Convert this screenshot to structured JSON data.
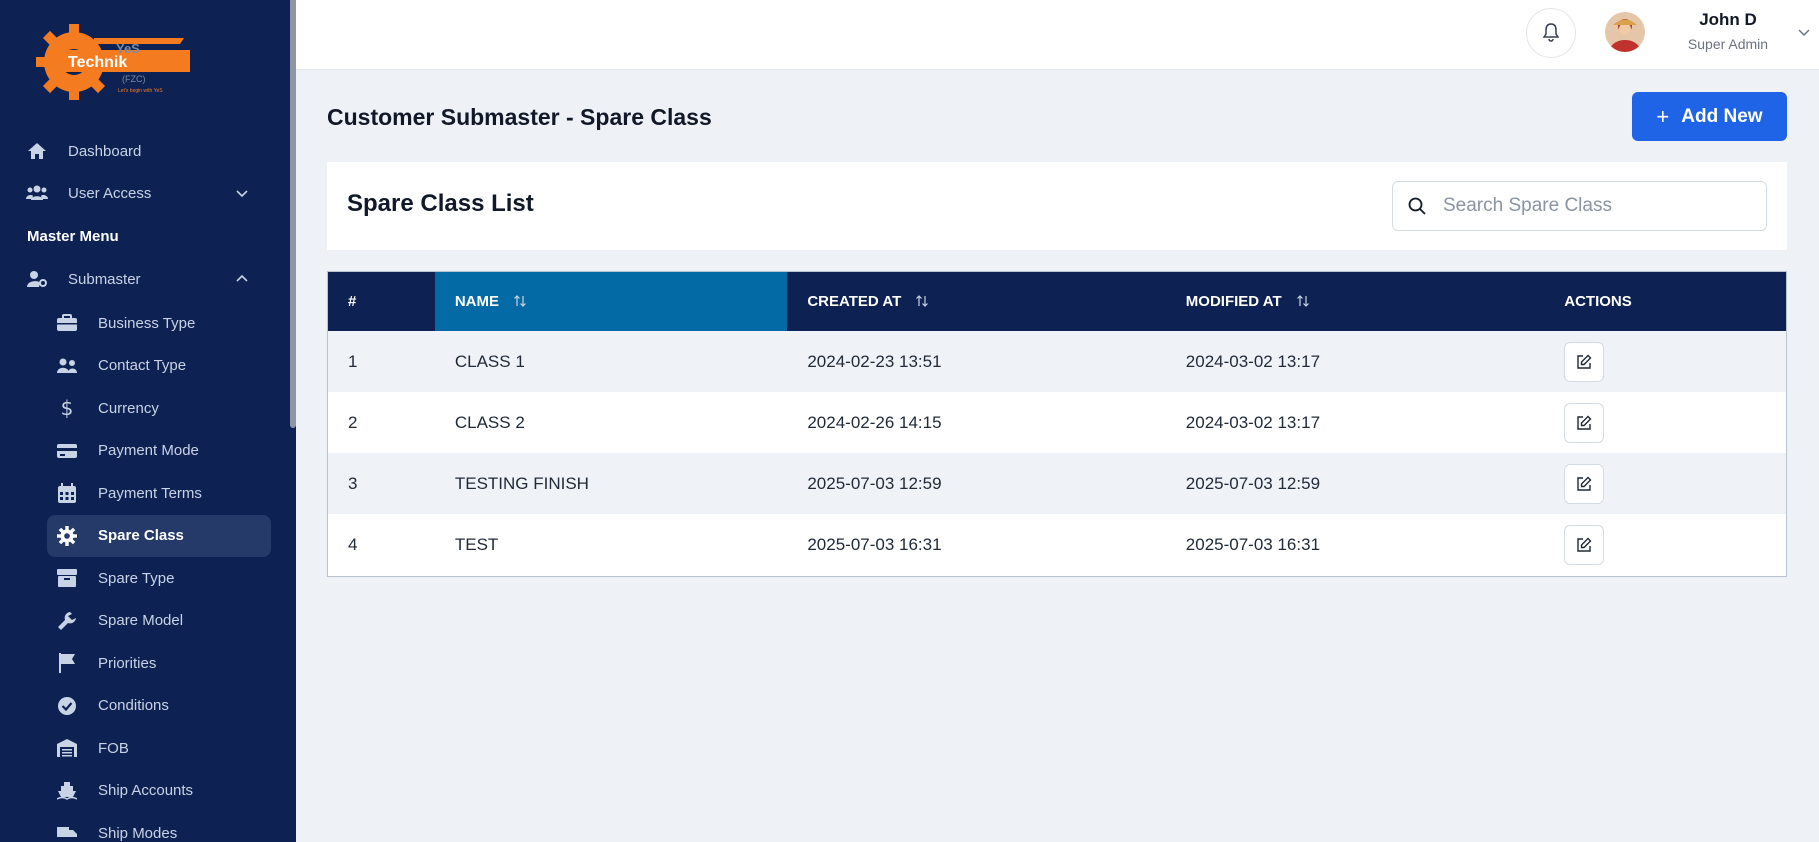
{
  "brand": {
    "logo_text": "Technik",
    "logo_subtext": "(FZC)",
    "logo_top": "YeS",
    "tagline": "Let's begin with YeS"
  },
  "sidebar": {
    "top_items": [
      {
        "label": "Dashboard",
        "icon": "home-icon"
      },
      {
        "label": "User Access",
        "icon": "users-icon"
      }
    ],
    "section_heading": "Master Menu",
    "group": {
      "label": "Submaster",
      "icon": "user-cog-icon"
    },
    "sub_items": [
      {
        "label": "Business Type",
        "icon": "briefcase-icon"
      },
      {
        "label": "Contact Type",
        "icon": "contacts-icon"
      },
      {
        "label": "Currency",
        "icon": "dollar-icon"
      },
      {
        "label": "Payment Mode",
        "icon": "credit-card-icon"
      },
      {
        "label": "Payment Terms",
        "icon": "calendar-icon"
      },
      {
        "label": "Spare Class",
        "icon": "gear-icon",
        "active": true
      },
      {
        "label": "Spare Type",
        "icon": "box-icon"
      },
      {
        "label": "Spare Model",
        "icon": "wrench-icon"
      },
      {
        "label": "Priorities",
        "icon": "flag-icon"
      },
      {
        "label": "Conditions",
        "icon": "check-circle-icon"
      },
      {
        "label": "FOB",
        "icon": "warehouse-icon"
      },
      {
        "label": "Ship Accounts",
        "icon": "ship-icon"
      },
      {
        "label": "Ship Modes",
        "icon": "truck-icon"
      }
    ]
  },
  "header": {
    "user_name": "John D",
    "user_role": "Super Admin"
  },
  "page": {
    "title": "Customer Submaster - Spare Class",
    "add_label": "Add New"
  },
  "list": {
    "title": "Spare Class List",
    "search_placeholder": "Search Spare Class"
  },
  "table": {
    "columns": [
      "#",
      "NAME",
      "CREATED AT",
      "MODIFIED AT",
      "ACTIONS"
    ],
    "rows": [
      {
        "idx": "1",
        "name": "CLASS 1",
        "created": "2024-02-23 13:51",
        "modified": "2024-03-02 13:17"
      },
      {
        "idx": "2",
        "name": "CLASS 2",
        "created": "2024-02-26 14:15",
        "modified": "2024-03-02 13:17"
      },
      {
        "idx": "3",
        "name": "TESTING FINISH",
        "created": "2025-07-03 12:59",
        "modified": "2025-07-03 12:59"
      },
      {
        "idx": "4",
        "name": "TEST",
        "created": "2025-07-03 16:31",
        "modified": "2025-07-03 16:31"
      }
    ]
  },
  "colors": {
    "sidebar_bg": "#0d2152",
    "accent": "#1f63e6",
    "sorted_header": "#046aa5",
    "logo_orange": "#f47b20"
  }
}
